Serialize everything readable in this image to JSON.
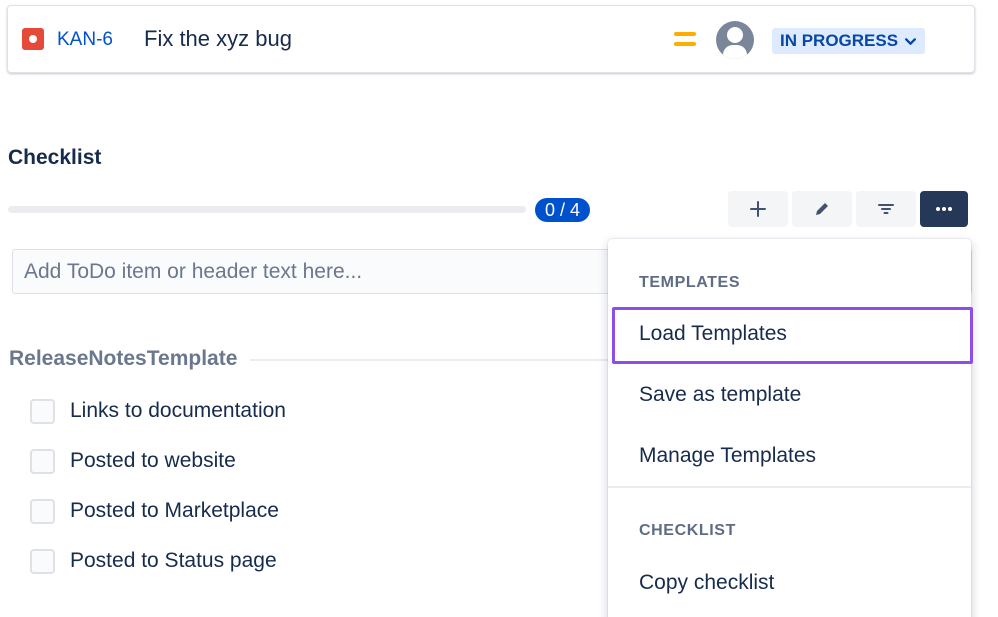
{
  "issue": {
    "key": "KAN-6",
    "summary": "Fix the xyz bug",
    "status": "IN PROGRESS",
    "type_icon": "bug-icon",
    "priority_icon": "priority-medium-icon",
    "colors": {
      "key": "#0052cc",
      "status_bg": "#deebff",
      "status_text": "#0747a6",
      "bug": "#e5493a",
      "priority": "#ffab00"
    }
  },
  "checklist": {
    "title": "Checklist",
    "progress_text": "0 / 4",
    "progress_fraction": 0,
    "input_placeholder": "Add ToDo item or header text here...",
    "toolbar": [
      "plus-icon",
      "pencil-icon",
      "filter-icon",
      "more-icon"
    ],
    "section": "ReleaseNotesTemplate",
    "items": [
      {
        "label": "Links to documentation",
        "checked": false
      },
      {
        "label": "Posted to website",
        "checked": false
      },
      {
        "label": "Posted to Marketplace",
        "checked": false
      },
      {
        "label": "Posted to Status page",
        "checked": false
      }
    ]
  },
  "menu": {
    "templates_title": "TEMPLATES",
    "load_templates": "Load Templates",
    "save_as_template": "Save as template",
    "manage_templates": "Manage Templates",
    "checklist_title": "CHECKLIST",
    "copy_checklist": "Copy checklist",
    "highlight_color": "#8e4de8"
  }
}
